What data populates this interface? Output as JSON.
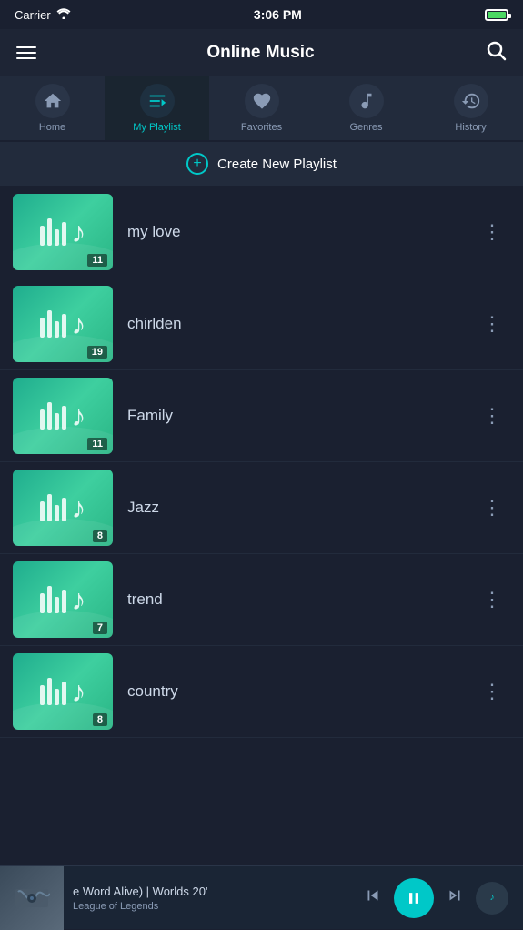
{
  "statusBar": {
    "carrier": "Carrier",
    "time": "3:06 PM"
  },
  "header": {
    "title": "Online Music"
  },
  "tabs": [
    {
      "id": "home",
      "label": "Home",
      "icon": "home",
      "active": false
    },
    {
      "id": "myplaylist",
      "label": "My Playlist",
      "icon": "playlist",
      "active": true
    },
    {
      "id": "favorites",
      "label": "Favorites",
      "icon": "heart",
      "active": false
    },
    {
      "id": "genres",
      "label": "Genres",
      "icon": "music",
      "active": false
    },
    {
      "id": "history",
      "label": "History",
      "icon": "history",
      "active": false
    }
  ],
  "createPlaylistLabel": "Create New Playlist",
  "playlists": [
    {
      "name": "my love",
      "count": 11
    },
    {
      "name": "chirlden",
      "count": 19
    },
    {
      "name": "Family",
      "count": 11
    },
    {
      "name": "Jazz",
      "count": 8
    },
    {
      "name": "trend",
      "count": 7
    },
    {
      "name": "country",
      "count": 8
    }
  ],
  "nowPlaying": {
    "title": "e Word Alive) | Worlds 20'",
    "artist": "League of Legends"
  }
}
